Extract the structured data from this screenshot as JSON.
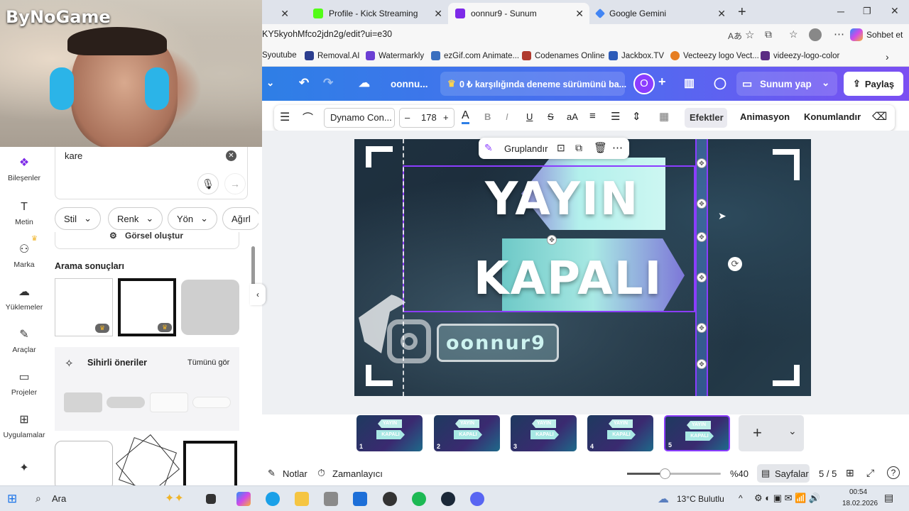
{
  "webcam": {
    "logo_text": "ByNoGame"
  },
  "browser": {
    "tabs": [
      {
        "label": "Profile - Kick Streaming",
        "color": "#53fc18"
      },
      {
        "label": "oonnur9 - Sunum",
        "color": "#7d2ae8"
      },
      {
        "label": "Google Gemini",
        "color": "#4285f4"
      }
    ],
    "new_tab": "+",
    "url": "KY5kyohMfco2jdn2g/edit?ui=e30",
    "copilot_label": "Sohbet et",
    "bookmarks": [
      {
        "label": "Syoutube",
        "color": "#ff0000"
      },
      {
        "label": "Removal.AI",
        "color": "#2c3e8f"
      },
      {
        "label": "Watermarkly",
        "color": "#6b3fd4"
      },
      {
        "label": "ezGif.com Animate...",
        "color": "#3a6fbf"
      },
      {
        "label": "Codenames Online",
        "color": "#b03a2e"
      },
      {
        "label": "Jackbox.TV",
        "color": "#2e5cb8"
      },
      {
        "label": "Vecteezy logo Vect...",
        "color": "#e67e22"
      },
      {
        "label": "videezy-logo-color",
        "color": "#5b2c83"
      }
    ]
  },
  "canva": {
    "doc_title": "oonnu...",
    "trial_banner": "0 ₺ karşılığında deneme sürümünü ba...",
    "avatar_letter": "O",
    "present_label": "Sunum yap",
    "share_label": "Paylaş",
    "text_toolbar": {
      "font": "Dynamo Con...",
      "size": "178",
      "minus": "–",
      "plus": "+",
      "effects": "Efektler",
      "animation": "Animasyon",
      "position": "Konumlandır"
    },
    "context_menu": {
      "group": "Gruplandır"
    },
    "slide": {
      "line1": "YAYIN",
      "line2": "KAPALI",
      "username": "oonnur9"
    },
    "thumbnails": [
      {
        "num": "1",
        "l1": "YAYIN",
        "l2": "KAPALI"
      },
      {
        "num": "2",
        "l1": "YAYIN",
        "l2": "KAPALI"
      },
      {
        "num": "3",
        "l1": "YAYIN",
        "l2": "KAPALI"
      },
      {
        "num": "4",
        "l1": "YAYIN",
        "l2": "KAPALI"
      },
      {
        "num": "5",
        "l1": "YAYIN",
        "l2": "KAPALI"
      }
    ],
    "add_page": "+",
    "bottom": {
      "notes": "Notlar",
      "timer": "Zamanlayıcı",
      "zoom": "%40",
      "zoom_level": 0.4,
      "pages_label": "Sayfalar",
      "page_count": "5 / 5",
      "help": "?"
    }
  },
  "sidebar": {
    "rail": [
      {
        "label": "Bileşenler",
        "icon": "elements-icon"
      },
      {
        "label": "Metin",
        "icon": "text-icon"
      },
      {
        "label": "Marka",
        "icon": "brand-icon"
      },
      {
        "label": "Yüklemeler",
        "icon": "upload-icon"
      },
      {
        "label": "Araçlar",
        "icon": "tools-icon"
      },
      {
        "label": "Projeler",
        "icon": "folder-icon"
      },
      {
        "label": "Uygulamalar",
        "icon": "apps-icon"
      }
    ],
    "search_value": "kare",
    "filters": [
      "Stil",
      "Renk",
      "Yön",
      "Ağırl"
    ],
    "generate_label": "Görsel oluştur",
    "results_title": "Arama sonuçları",
    "magic_title": "Sihirli öneriler",
    "see_all": "Tümünü gör"
  },
  "taskbar": {
    "search": "Ara",
    "weather": "13°C  Bulutlu",
    "time": "00:54",
    "date": "18.02.2026"
  }
}
